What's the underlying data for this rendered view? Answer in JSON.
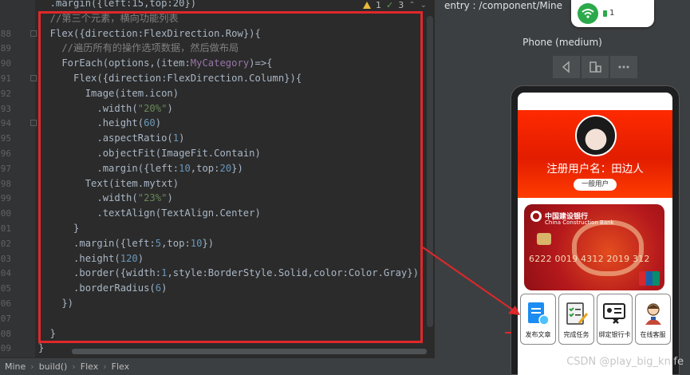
{
  "editor": {
    "lines": [
      {
        "num": "",
        "tokens": [
          {
            "t": "  .margin({left:15,top:20})",
            "c": "plain"
          }
        ]
      },
      {
        "num": "",
        "tokens": [
          {
            "t": "  //第三个元素，横向功能列表",
            "c": "comment"
          }
        ]
      },
      {
        "num": "88",
        "tokens": [
          {
            "t": "  Flex",
            "c": "plain"
          },
          {
            "t": "({direction:FlexDirection.Row})",
            "c": "plain"
          },
          {
            "t": "{",
            "c": "plain"
          }
        ]
      },
      {
        "num": "89",
        "tokens": [
          {
            "t": "    //遍历所有的操作选项数据，然后做布局",
            "c": "comment"
          }
        ]
      },
      {
        "num": "90",
        "tokens": [
          {
            "t": "    ForEach",
            "c": "plain"
          },
          {
            "t": "(options,(item:",
            "c": "plain"
          },
          {
            "t": "MyCategory",
            "c": "kw"
          },
          {
            "t": ")=>{",
            "c": "plain"
          }
        ]
      },
      {
        "num": "91",
        "tokens": [
          {
            "t": "      Flex",
            "c": "plain"
          },
          {
            "t": "({direction:FlexDirection.Column})",
            "c": "plain"
          },
          {
            "t": "{",
            "c": "plain"
          }
        ]
      },
      {
        "num": "92",
        "tokens": [
          {
            "t": "        Image",
            "c": "plain"
          },
          {
            "t": "(item.icon)",
            "c": "plain"
          }
        ]
      },
      {
        "num": "93",
        "tokens": [
          {
            "t": "          .width(",
            "c": "plain"
          },
          {
            "t": "\"20%\"",
            "c": "str"
          },
          {
            "t": ")",
            "c": "plain"
          }
        ]
      },
      {
        "num": "94",
        "tokens": [
          {
            "t": "          .height(",
            "c": "plain"
          },
          {
            "t": "60",
            "c": "num"
          },
          {
            "t": ")",
            "c": "plain"
          }
        ]
      },
      {
        "num": "95",
        "tokens": [
          {
            "t": "          .aspectRatio(",
            "c": "plain"
          },
          {
            "t": "1",
            "c": "num"
          },
          {
            "t": ")",
            "c": "plain"
          }
        ]
      },
      {
        "num": "96",
        "tokens": [
          {
            "t": "          .objectFit(ImageFit.Contain)",
            "c": "plain"
          }
        ]
      },
      {
        "num": "97",
        "tokens": [
          {
            "t": "          .margin({left:",
            "c": "plain"
          },
          {
            "t": "10",
            "c": "num"
          },
          {
            "t": ",top:",
            "c": "plain"
          },
          {
            "t": "20",
            "c": "num"
          },
          {
            "t": "})",
            "c": "plain"
          }
        ]
      },
      {
        "num": "98",
        "tokens": [
          {
            "t": "        Text",
            "c": "plain"
          },
          {
            "t": "(item.",
            "c": "plain"
          },
          {
            "t": "mytxt",
            "c": "plain"
          },
          {
            "t": ")",
            "c": "plain"
          }
        ]
      },
      {
        "num": "99",
        "tokens": [
          {
            "t": "          .width(",
            "c": "plain"
          },
          {
            "t": "\"23%\"",
            "c": "str"
          },
          {
            "t": ")",
            "c": "plain"
          }
        ]
      },
      {
        "num": "00",
        "tokens": [
          {
            "t": "          .textAlign(TextAlign.Center)",
            "c": "plain"
          }
        ]
      },
      {
        "num": "01",
        "tokens": [
          {
            "t": "      }",
            "c": "plain"
          }
        ]
      },
      {
        "num": "02",
        "tokens": [
          {
            "t": "      .margin({left:",
            "c": "plain"
          },
          {
            "t": "5",
            "c": "num"
          },
          {
            "t": ",top:",
            "c": "plain"
          },
          {
            "t": "10",
            "c": "num"
          },
          {
            "t": "})",
            "c": "plain"
          }
        ]
      },
      {
        "num": "03",
        "tokens": [
          {
            "t": "      .height(",
            "c": "plain"
          },
          {
            "t": "120",
            "c": "num"
          },
          {
            "t": ")",
            "c": "plain"
          }
        ]
      },
      {
        "num": "04",
        "tokens": [
          {
            "t": "      .border({width:",
            "c": "plain"
          },
          {
            "t": "1",
            "c": "num"
          },
          {
            "t": ",style:BorderStyle.Solid,color:Color.Gray})",
            "c": "plain"
          }
        ]
      },
      {
        "num": "05",
        "tokens": [
          {
            "t": "      .borderRadius(",
            "c": "plain"
          },
          {
            "t": "6",
            "c": "num"
          },
          {
            "t": ")",
            "c": "plain"
          }
        ]
      },
      {
        "num": "06",
        "tokens": [
          {
            "t": "    })",
            "c": "plain"
          }
        ]
      },
      {
        "num": "07",
        "tokens": [
          {
            "t": "",
            "c": "plain"
          }
        ]
      },
      {
        "num": "08",
        "tokens": [
          {
            "t": "  }",
            "c": "plain"
          }
        ]
      },
      {
        "num": "09",
        "tokens": [
          {
            "t": "}",
            "c": "plain"
          }
        ]
      }
    ],
    "inspection": {
      "warnings": "1",
      "ok": "3"
    }
  },
  "breadcrumbs": [
    "Mine",
    "build()",
    "Flex",
    "Flex"
  ],
  "previewer": {
    "entry_title": "entry : /component/Mine",
    "device_label": "Phone (medium)",
    "status_count": "1",
    "app": {
      "user_name": "注册用户名：田边人",
      "user_level": "一般用户",
      "bank_name_cn": "中国建设银行",
      "bank_name_en": "China Construction Bank",
      "card_number": "6222 0019 4312 2019 312",
      "features": [
        {
          "label": "发布文章",
          "icon": "publish-article-icon"
        },
        {
          "label": "完成任务",
          "icon": "task-checklist-icon"
        },
        {
          "label": "绑定银行卡",
          "icon": "bind-bank-card-icon"
        },
        {
          "label": "在线客服",
          "icon": "online-service-icon"
        }
      ]
    }
  },
  "watermark": "CSDN @play_big_knife",
  "colors": {
    "highlight": "#e0272a",
    "header_red": "#ff2a00",
    "editor_bg": "#2b2b2b"
  }
}
